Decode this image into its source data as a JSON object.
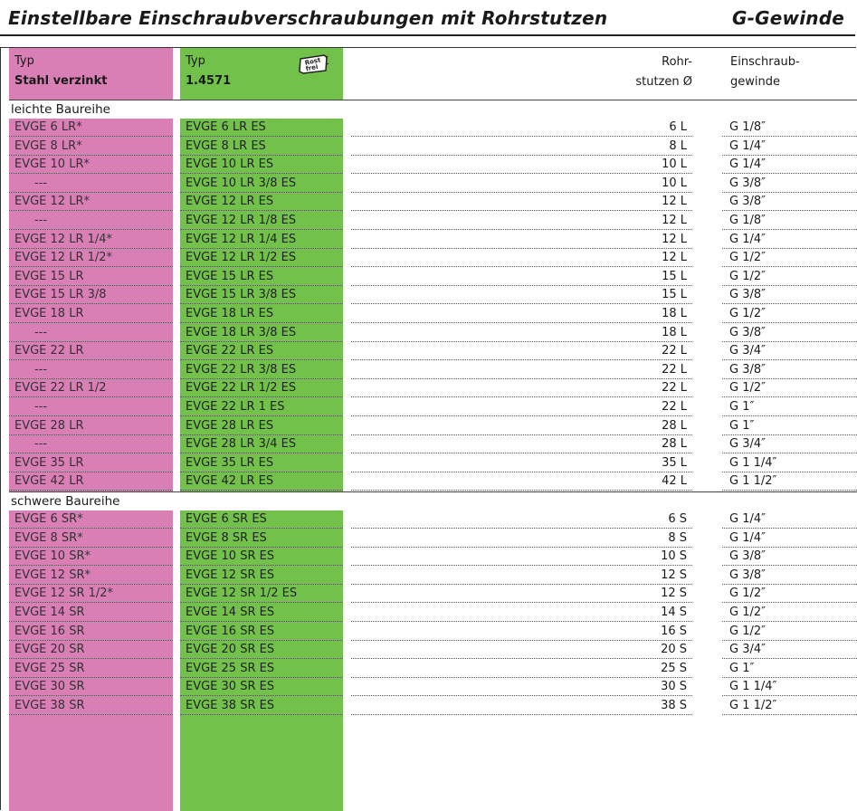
{
  "title": {
    "left": "Einstellbare Einschraubverschraubungen mit Rohrstutzen",
    "right": "G-Gewinde"
  },
  "headers": {
    "col1": {
      "line1": "Typ",
      "line2": "Stahl verzinkt"
    },
    "col2": {
      "line1": "Typ",
      "line2": "1.4571"
    },
    "col3": {
      "line1": "Rohr-",
      "line2": "stutzen Ø"
    },
    "col4": {
      "line1": "Einschraub-",
      "line2": "gewinde"
    },
    "badge_text": "Rost frei"
  },
  "colors": {
    "pink": "#d97fb5",
    "green": "#72c14a"
  },
  "sections": [
    {
      "title": "leichte Baureihe",
      "rows": [
        [
          "EVGE 6 LR*",
          "EVGE 6 LR ES",
          "6 L",
          "G 1/8″"
        ],
        [
          "EVGE 8 LR*",
          "EVGE 8 LR ES",
          "8 L",
          "G 1/4″"
        ],
        [
          "EVGE 10 LR*",
          "EVGE 10 LR ES",
          "10 L",
          "G 1/4″"
        ],
        [
          "---",
          "EVGE 10 LR 3/8 ES",
          "10 L",
          "G 3/8″"
        ],
        [
          "EVGE 12 LR*",
          "EVGE 12 LR ES",
          "12 L",
          "G 3/8″"
        ],
        [
          "---",
          "EVGE 12 LR 1/8 ES",
          "12 L",
          "G 1/8″"
        ],
        [
          "EVGE 12 LR 1/4*",
          "EVGE 12 LR 1/4 ES",
          "12 L",
          "G 1/4″"
        ],
        [
          "EVGE 12 LR 1/2*",
          "EVGE 12 LR 1/2 ES",
          "12 L",
          "G 1/2″"
        ],
        [
          "EVGE 15 LR",
          "EVGE 15 LR ES",
          "15 L",
          "G 1/2″"
        ],
        [
          "EVGE 15 LR 3/8",
          "EVGE 15 LR 3/8 ES",
          "15 L",
          "G 3/8″"
        ],
        [
          "EVGE 18 LR",
          "EVGE 18 LR ES",
          "18 L",
          "G 1/2″"
        ],
        [
          "---",
          "EVGE 18 LR 3/8 ES",
          "18 L",
          "G 3/8″"
        ],
        [
          "EVGE 22 LR",
          "EVGE 22 LR ES",
          "22 L",
          "G 3/4″"
        ],
        [
          "---",
          "EVGE 22 LR 3/8 ES",
          "22 L",
          "G 3/8″"
        ],
        [
          "EVGE 22 LR 1/2",
          "EVGE 22 LR 1/2 ES",
          "22 L",
          "G 1/2″"
        ],
        [
          "---",
          "EVGE 22 LR 1 ES",
          "22 L",
          "G 1″"
        ],
        [
          "EVGE 28 LR",
          "EVGE 28 LR ES",
          "28 L",
          "G 1″"
        ],
        [
          "---",
          "EVGE 28 LR 3/4 ES",
          "28 L",
          "G 3/4″"
        ],
        [
          "EVGE 35 LR",
          "EVGE 35 LR ES",
          "35 L",
          "G 1 1/4″"
        ],
        [
          "EVGE 42 LR",
          "EVGE 42 LR ES",
          "42 L",
          "G 1 1/2″"
        ]
      ]
    },
    {
      "title": "schwere Baureihe",
      "rows": [
        [
          "EVGE 6 SR*",
          "EVGE 6 SR ES",
          "6 S",
          "G 1/4″"
        ],
        [
          "EVGE 8 SR*",
          "EVGE 8 SR ES",
          "8 S",
          "G 1/4″"
        ],
        [
          "EVGE 10 SR*",
          "EVGE 10 SR ES",
          "10 S",
          "G 3/8″"
        ],
        [
          "EVGE 12 SR*",
          "EVGE 12 SR ES",
          "12 S",
          "G 3/8″"
        ],
        [
          "EVGE 12 SR 1/2*",
          "EVGE 12 SR 1/2 ES",
          "12 S",
          "G 1/2″"
        ],
        [
          "EVGE 14 SR",
          "EVGE 14 SR ES",
          "14 S",
          "G 1/2″"
        ],
        [
          "EVGE 16 SR",
          "EVGE 16 SR ES",
          "16 S",
          "G 1/2″"
        ],
        [
          "EVGE 20 SR",
          "EVGE 20 SR ES",
          "20 S",
          "G 3/4″"
        ],
        [
          "EVGE 25 SR",
          "EVGE 25 SR ES",
          "25 S",
          "G 1″"
        ],
        [
          "EVGE 30 SR",
          "EVGE 30 SR ES",
          "30 S",
          "G 1 1/4″"
        ],
        [
          "EVGE 38 SR",
          "EVGE 38 SR ES",
          "38 S",
          "G 1 1/2″"
        ]
      ]
    }
  ]
}
